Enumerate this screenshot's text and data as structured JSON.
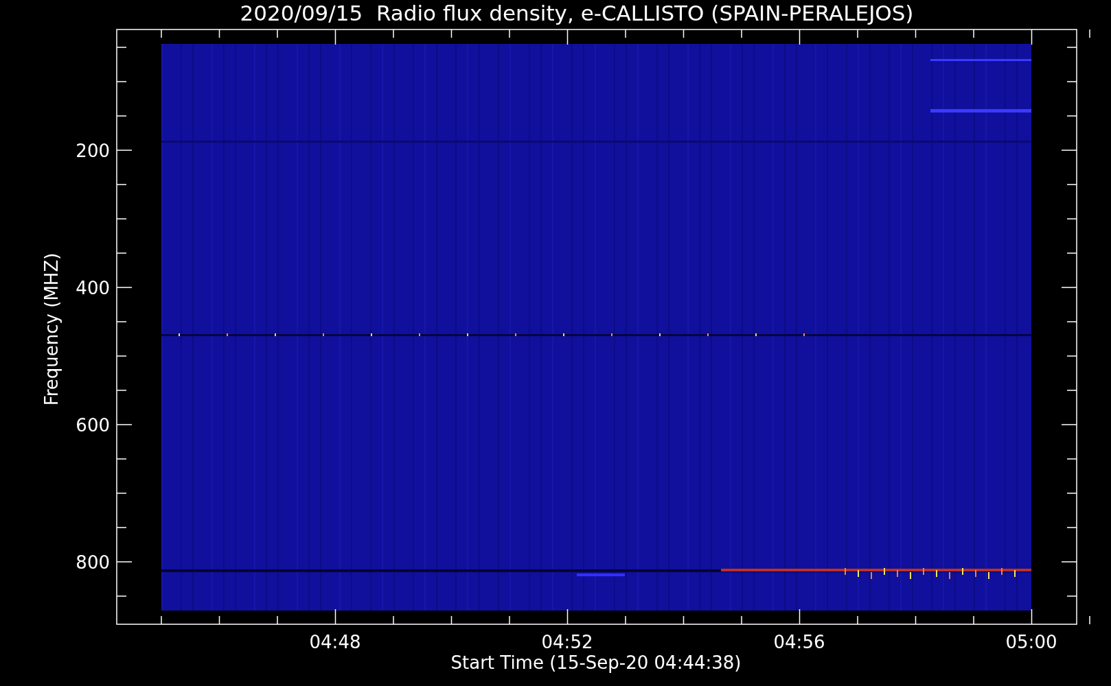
{
  "plot": {
    "title": "2020/09/15  Radio flux density, e-CALLISTO (SPAIN-PERALEJOS)",
    "ylabel": "Frequency (MHZ)",
    "xlabel": "Start Time (15-Sep-20 04:44:38)",
    "yticks": [
      "200",
      "400",
      "600",
      "800"
    ],
    "xticks": [
      "04:48",
      "04:52",
      "04:56",
      "05:00"
    ]
  }
}
